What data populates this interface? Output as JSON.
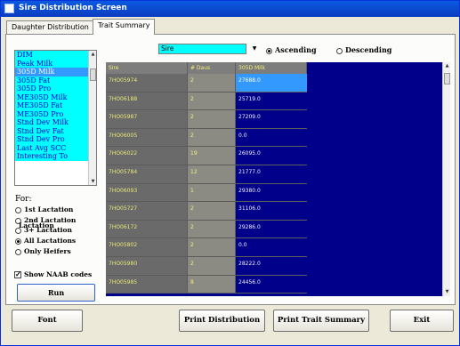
{
  "window": {
    "title": "Sire Distribution Screen"
  },
  "tabs": [
    {
      "label": "Daughter Distribution",
      "active": false
    },
    {
      "label": "Trait Summary",
      "active": true
    }
  ],
  "traits": {
    "items": [
      "DIM",
      "Peak Milk",
      "305D Milk",
      "305D Fat",
      "305D Pro",
      "ME305D Milk",
      "ME305D Fat",
      "ME305D Pro",
      "Stnd Dev Milk",
      "Stnd Dev Fat",
      "Stnd Dev Pro",
      "Last Avg SCC",
      "Interesting To"
    ],
    "selected_index": 2
  },
  "for_group": {
    "label": "For:",
    "options": [
      "1st Lactation",
      "2nd Lactation",
      "3+ Lactation",
      "All Lactations",
      "Only Heifers"
    ],
    "selected": "All Lactations",
    "overlap_text": "Lactation"
  },
  "show_naab": {
    "label": "Show NAAB codes",
    "checked": true
  },
  "run_button": "Run",
  "sort": {
    "field": "Sire",
    "ascending_label": "Ascending",
    "descending_label": "Descending",
    "selected": "Ascending"
  },
  "grid": {
    "columns": [
      "Sire",
      "# Daus",
      "305D Milk"
    ],
    "rows": [
      {
        "id": "7HO05974",
        "daus": "2",
        "value": "27688.0",
        "selected": true
      },
      {
        "id": "7HO06188",
        "daus": "2",
        "value": "25719.0"
      },
      {
        "id": "7HO05987",
        "daus": "2",
        "value": "27209.0"
      },
      {
        "id": "7HO06005",
        "daus": "2",
        "value": "0.0"
      },
      {
        "id": "7HO06022",
        "daus": "19",
        "value": "26095.0"
      },
      {
        "id": "7HO05784",
        "daus": "12",
        "value": "21777.0"
      },
      {
        "id": "7HO06093",
        "daus": "1",
        "value": "29380.0"
      },
      {
        "id": "7HO05727",
        "daus": "2",
        "value": "31106.0"
      },
      {
        "id": "7HO06172",
        "daus": "2",
        "value": "29286.0"
      },
      {
        "id": "7HO05802",
        "daus": "2",
        "value": "0.0"
      },
      {
        "id": "7HO05980",
        "daus": "2",
        "value": "28222.0"
      },
      {
        "id": "7HO05985",
        "daus": "8",
        "value": "24456.0"
      }
    ]
  },
  "buttons": {
    "font": "Font",
    "print_distribution": "Print Distribution",
    "print_trait_summary": "Print Trait Summary",
    "exit": "Exit"
  },
  "colors": {
    "title_bar": "#0b4ad8",
    "list_background": "#00ffff",
    "selection": "#3399ff",
    "grid_background": "#00008b",
    "grid_header_text": "#f0f07a"
  }
}
